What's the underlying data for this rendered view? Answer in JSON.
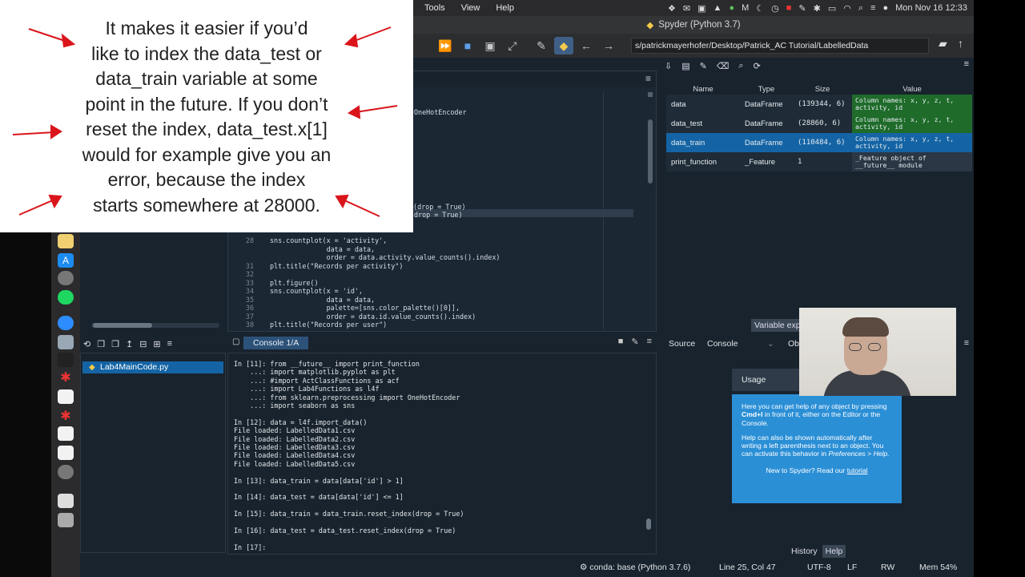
{
  "menubar": {
    "items": [
      "Tools",
      "View",
      "Help"
    ],
    "clock": "Mon Nov 16  12:33"
  },
  "window": {
    "title": "Spyder (Python 3.7)"
  },
  "toolbar": {
    "path": "s/patrickmayerhofer/Desktop/Patrick_AC Tutorial/LabelledData"
  },
  "annotation": {
    "lines": [
      "It makes it easier if you’d",
      "like to index the data_test or",
      "data_train variable at some",
      "point in the future. If you don’t",
      "reset the index, data_test.x[1]",
      "would for example give you an",
      "error, because the index",
      "starts somewhere at 28000."
    ]
  },
  "editor": {
    "partial_lines": [
      {
        "text": "OneHotEncoder"
      },
      {
        "text": "x(drop = True)"
      },
      {
        "text": "drop = True)"
      }
    ],
    "lines": [
      {
        "num": "28",
        "code": "sns.countplot(x = 'activity',",
        "str": ""
      },
      {
        "num": "",
        "code": "              data = data,",
        "str": ""
      },
      {
        "num": "",
        "code": "              order = data.activity.value_counts().index)",
        "str": ""
      },
      {
        "num": "31",
        "code": "plt.title(\"Records per activity\")",
        "str": ""
      },
      {
        "num": "32",
        "code": "",
        "str": ""
      },
      {
        "num": "33",
        "code": "plt.figure()",
        "str": ""
      },
      {
        "num": "34",
        "code": "sns.countplot(x = 'id',",
        "str": ""
      },
      {
        "num": "35",
        "code": "              data = data,",
        "str": ""
      },
      {
        "num": "36",
        "code": "              palette=[sns.color_palette()[0]],",
        "str": ""
      },
      {
        "num": "37",
        "code": "              order = data.id.value_counts().index)",
        "str": ""
      },
      {
        "num": "38",
        "code": "plt.title(\"Records per user\")",
        "str": ""
      }
    ]
  },
  "files": {
    "selected": "Lab4MainCode.py"
  },
  "console": {
    "tab": "Console 1/A",
    "lines": [
      "In [11]: from __future__ import print_function",
      "    ...: import matplotlib.pyplot as plt",
      "    ...: #import ActClassFunctions as acf",
      "    ...: import Lab4Functions as l4f",
      "    ...: from sklearn.preprocessing import OneHotEncoder",
      "    ...: import seaborn as sns",
      "",
      "In [12]: data = l4f.import_data()",
      "File loaded: LabelledData1.csv",
      "File loaded: LabelledData2.csv",
      "File loaded: LabelledData3.csv",
      "File loaded: LabelledData4.csv",
      "File loaded: LabelledData5.csv",
      "",
      "In [13]: data_train = data[data['id'] > 1]",
      "",
      "In [14]: data_test = data[data['id'] <= 1]",
      "",
      "In [15]: data_train = data_train.reset_index(drop = True)",
      "",
      "In [16]: data_test = data_test.reset_index(drop = True)",
      "",
      "In [17]: "
    ]
  },
  "variables": {
    "headers": [
      "Name",
      "Type",
      "Size",
      "Value"
    ],
    "rows": [
      {
        "name": "data",
        "type": "DataFrame",
        "size": "(139344, 6)",
        "value1": "Column names: x, y, z, t,",
        "value2": "activity, id",
        "color": "#1e6b2a"
      },
      {
        "name": "data_test",
        "type": "DataFrame",
        "size": "(28860, 6)",
        "value1": "Column names: x, y, z, t,",
        "value2": "activity, id",
        "color": "#1e6b2a"
      },
      {
        "name": "data_train",
        "type": "DataFrame",
        "size": "(110484, 6)",
        "value1": "Column names: x, y, z, t,",
        "value2": "activity, id",
        "color": "#1464a5"
      },
      {
        "name": "print_function",
        "type": "_Feature",
        "size": "1",
        "value1": "_Feature object of",
        "value2": "__future__ module",
        "color": "#2b3744"
      }
    ],
    "tab": "Variable exp"
  },
  "help": {
    "source_label": "Source",
    "source_value": "Console",
    "obj": "Ob",
    "usage_title": "Usage",
    "p1_pre": "Here you can get help of any object by pressing ",
    "p1_key": "Cmd+I",
    "p1_post": " in front of it, either on the Editor or the Console.",
    "p2": "Help can also be shown automatically after writing a left parenthesis next to an object. You can activate this behavior in ",
    "p2_link": "Preferences > Help.",
    "footer_pre": "New to Spyder? Read our ",
    "footer_link": "tutorial",
    "tabs": [
      "History",
      "Help"
    ]
  },
  "status": {
    "conda": "conda: base (Python 3.7.6)",
    "pos": "Line 25, Col 47",
    "enc": "UTF-8",
    "eol": "LF",
    "rw": "RW",
    "mem": "Mem 54%"
  }
}
